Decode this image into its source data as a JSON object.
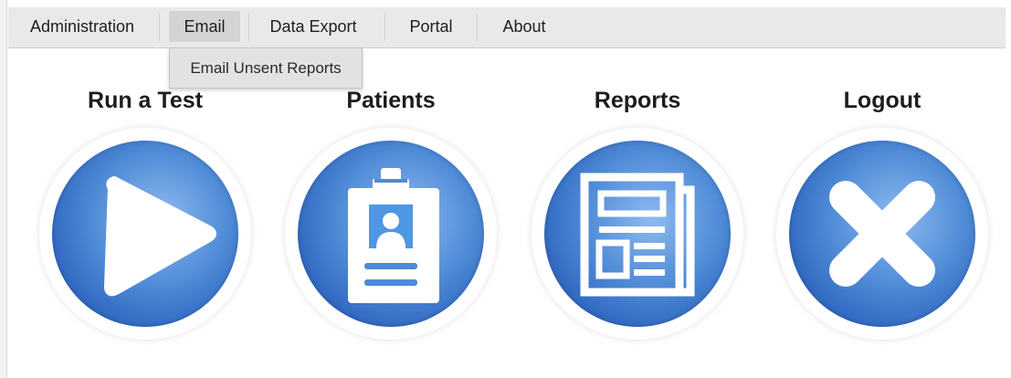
{
  "menu": {
    "items": [
      {
        "label": "Administration"
      },
      {
        "label": "Email"
      },
      {
        "label": "Data Export"
      },
      {
        "label": "Portal"
      },
      {
        "label": "About"
      }
    ],
    "active_item": "Email"
  },
  "dropdown": {
    "items": [
      {
        "label": "Email Unsent Reports"
      }
    ]
  },
  "tiles": [
    {
      "title": "Run a Test",
      "icon": "play-icon"
    },
    {
      "title": "Patients",
      "icon": "clipboard-patient-icon"
    },
    {
      "title": "Reports",
      "icon": "newspaper-report-icon"
    },
    {
      "title": "Logout",
      "icon": "close-x-icon"
    }
  ],
  "colors": {
    "menu_bg": "#e9e9e9",
    "active_menu_bg": "#d4d4d4",
    "disc_dark": "#2657ab",
    "disc_light": "#8fbaf0",
    "icon_white": "#ffffff"
  }
}
